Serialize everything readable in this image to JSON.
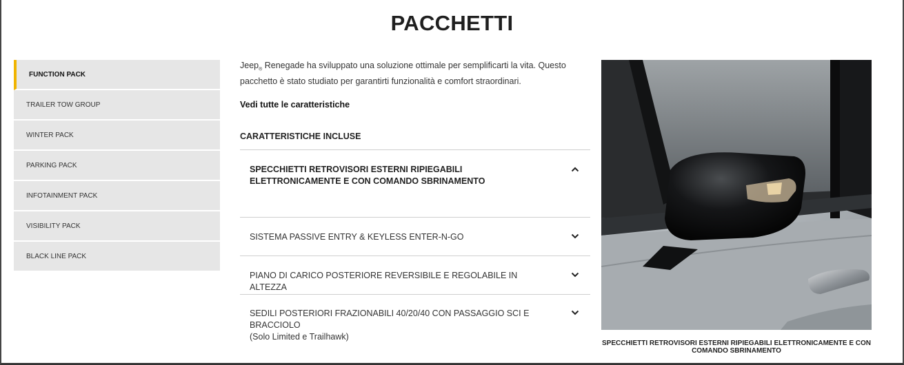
{
  "page": {
    "title": "PACCHETTI"
  },
  "sidebar": {
    "items": [
      {
        "label": "FUNCTION PACK",
        "active": true
      },
      {
        "label": "TRAILER TOW GROUP"
      },
      {
        "label": "WINTER PACK"
      },
      {
        "label": "PARKING PACK"
      },
      {
        "label": "INFOTAINMENT PACK"
      },
      {
        "label": "VISIBILITY PACK"
      },
      {
        "label": "BLACK LINE PACK"
      }
    ]
  },
  "content": {
    "intro_brand": "Jeep",
    "intro_reg": "®",
    "intro_text": " Renegade ha sviluppato una soluzione ottimale per semplificarti la vita. Questo pacchetto è stato studiato per garantirti funzionalità e comfort straordinari.",
    "see_all": "Vedi tutte le caratteristiche",
    "features_title": "CARATTERISTICHE INCLUSE",
    "features": [
      {
        "label": "SPECCHIETTI RETROVISORI ESTERNI RIPIEGABILI ELETTRONICAMENTE E CON COMANDO SBRINAMENTO",
        "expanded": true,
        "icon": "chevron-up-icon"
      },
      {
        "label": "SISTEMA PASSIVE ENTRY & KEYLESS ENTER-N-GO",
        "expanded": false,
        "icon": "chevron-down-icon"
      },
      {
        "label": "PIANO DI CARICO POSTERIORE REVERSIBILE E REGOLABILE IN ALTEZZA",
        "expanded": false,
        "icon": "chevron-down-icon"
      },
      {
        "label": "SEDILI POSTERIORI FRAZIONABILI 40/20/40 CON PASSAGGIO SCI E BRACCIOLO",
        "sub": "(Solo Limited e Trailhawk)",
        "expanded": false,
        "icon": "chevron-down-icon"
      }
    ]
  },
  "image": {
    "caption": "SPECCHIETTI RETROVISORI ESTERNI RIPIEGABILI ELETTRONICAMENTE E CON COMANDO SBRINAMENTO"
  },
  "colors": {
    "accent": "#f0b400",
    "sidebar_bg": "#e6e6e6",
    "divider": "#cfcfcf"
  }
}
